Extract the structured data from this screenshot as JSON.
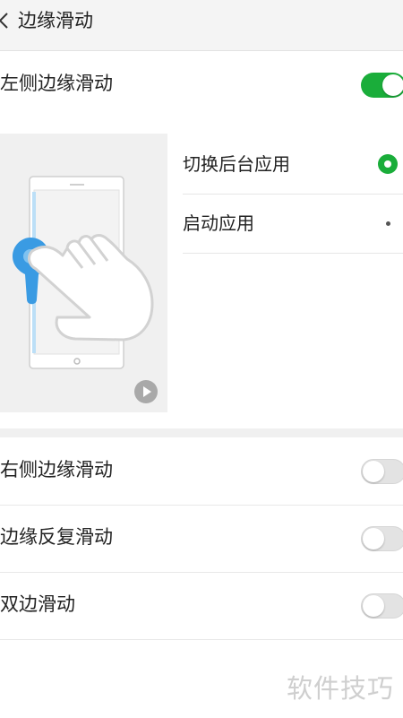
{
  "header": {
    "title": "边缘滑动",
    "back_icon": "chevron-left-icon"
  },
  "left_edge": {
    "label": "左侧边缘滑动",
    "enabled": true
  },
  "preview": {
    "play_icon": "play-icon"
  },
  "options": [
    {
      "label": "切换后台应用",
      "selected": true
    },
    {
      "label": "启动应用",
      "selected": false
    }
  ],
  "settings": [
    {
      "label": "右侧边缘滑动",
      "enabled": false
    },
    {
      "label": "边缘反复滑动",
      "enabled": false
    },
    {
      "label": "双边滑动",
      "enabled": false
    }
  ],
  "watermark": "软件技巧",
  "colors": {
    "accent": "#1aad3a",
    "touch_blue": "#3a9be3",
    "header_bg": "#f4f4f4"
  }
}
